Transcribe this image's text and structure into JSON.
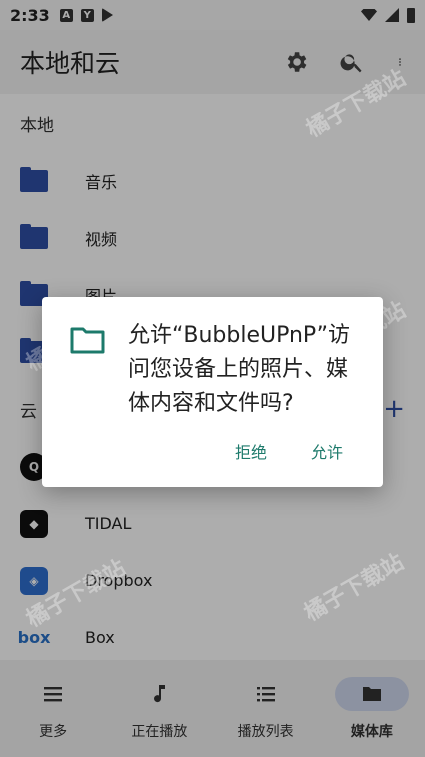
{
  "status_bar": {
    "time": "2:33",
    "icons": [
      "a-icon",
      "y-icon",
      "play-icon"
    ]
  },
  "app_bar": {
    "title": "本地和云"
  },
  "local": {
    "header": "本地",
    "items": [
      {
        "label": "音乐",
        "icon": "folder-icon"
      },
      {
        "label": "视频",
        "icon": "folder-icon"
      },
      {
        "label": "图片",
        "icon": "folder-icon"
      },
      {
        "label": "",
        "icon": "folder-icon"
      }
    ]
  },
  "cloud": {
    "header": "云",
    "add_label": "+",
    "items": [
      {
        "label": "",
        "icon": "qobuz-icon"
      },
      {
        "label": "TIDAL",
        "icon": "tidal-icon"
      },
      {
        "label": "Dropbox",
        "icon": "dropbox-icon"
      },
      {
        "label": "Box",
        "icon": "box-icon"
      }
    ]
  },
  "bottom_nav": {
    "items": [
      {
        "label": "更多",
        "icon": "menu-icon",
        "active": false
      },
      {
        "label": "正在播放",
        "icon": "music-note-icon",
        "active": false
      },
      {
        "label": "播放列表",
        "icon": "playlist-icon",
        "active": false
      },
      {
        "label": "媒体库",
        "icon": "library-icon",
        "active": true
      }
    ]
  },
  "dialog": {
    "title": "允许“BubbleUPnP”访问您设备上的照片、媒体内容和文件吗?",
    "deny_label": "拒绝",
    "allow_label": "允许",
    "accent_color": "#1d7a6b"
  },
  "watermark": {
    "text": "橘子下载站"
  },
  "colors": {
    "folder": "#2f4fa6",
    "nav_active_pill": "#cfd8ee"
  }
}
